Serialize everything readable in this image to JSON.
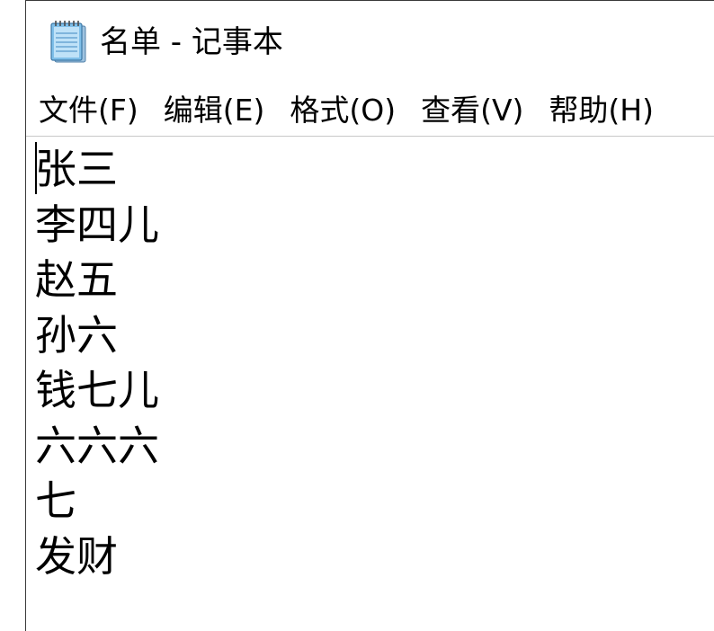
{
  "window": {
    "title": "名单 - 记事本",
    "icon": "notepad-icon"
  },
  "menu": {
    "items": [
      {
        "id": "file",
        "label": "文件(F)"
      },
      {
        "id": "edit",
        "label": "编辑(E)"
      },
      {
        "id": "format",
        "label": "格式(O)"
      },
      {
        "id": "view",
        "label": "查看(V)"
      },
      {
        "id": "help",
        "label": "帮助(H)"
      }
    ]
  },
  "editor": {
    "lines": [
      "张三",
      "李四儿",
      "赵五",
      "孙六",
      "钱七儿",
      "六六六",
      "七",
      "发财"
    ]
  },
  "colors": {
    "text": "#000000",
    "background": "#ffffff",
    "notepad_icon_blue": "#5aa8df"
  }
}
